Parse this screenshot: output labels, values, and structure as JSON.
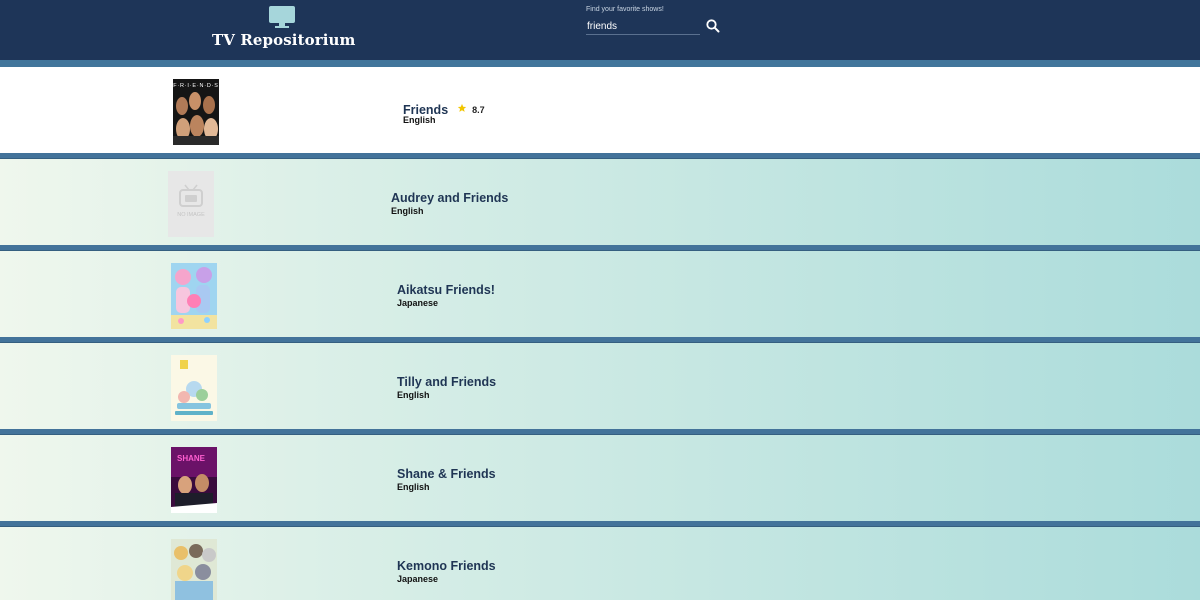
{
  "app": {
    "title": "TV Repositorium"
  },
  "search": {
    "hint": "Find your favorite shows!",
    "value": "friends"
  },
  "results": [
    {
      "title": "Friends",
      "rating": "8.7",
      "language": "English"
    },
    {
      "title": "Audrey and Friends",
      "language": "English",
      "poster_text": "NO IMAGE"
    },
    {
      "title": "Aikatsu Friends!",
      "language": "Japanese"
    },
    {
      "title": "Tilly and Friends",
      "language": "English"
    },
    {
      "title": "Shane & Friends",
      "language": "English",
      "poster_text": "SHANE"
    },
    {
      "title": "Kemono Friends",
      "language": "Japanese"
    }
  ],
  "icons": {
    "logo": "tv-icon",
    "search": "search-icon",
    "rating": "star-icon"
  },
  "colors": {
    "header": "#1e3558",
    "divider": "#43739a",
    "accent": "#a3d7dc",
    "star": "#f2c600"
  }
}
